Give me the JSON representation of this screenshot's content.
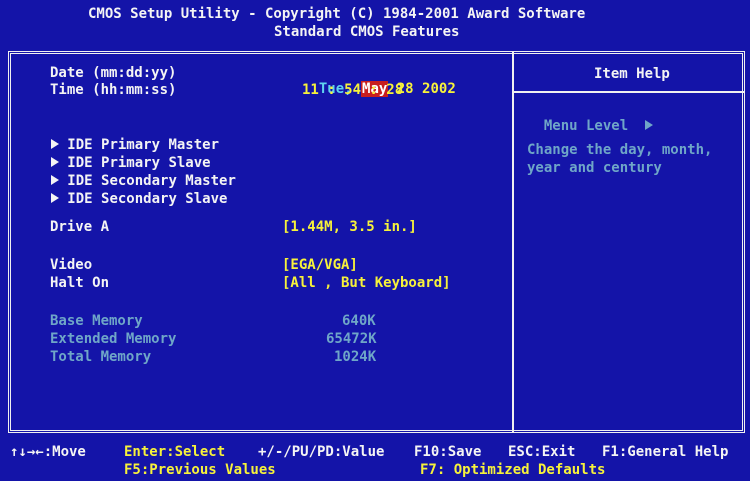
{
  "title": {
    "line1": "CMOS Setup Utility - Copyright (C) 1984-2001 Award Software",
    "line2": "Standard CMOS Features"
  },
  "fields": {
    "date": {
      "label": "Date (mm:dd:yy)",
      "day": "Tue,",
      "month": "May",
      "rest": "28 2002"
    },
    "time": {
      "label": "Time (hh:mm:ss)",
      "value": "11 : 54 : 28"
    },
    "ide": [
      {
        "label": "IDE Primary Master"
      },
      {
        "label": "IDE Primary Slave"
      },
      {
        "label": "IDE Secondary Master"
      },
      {
        "label": "IDE Secondary Slave"
      }
    ],
    "drive_a": {
      "label": "Drive A",
      "value": "[1.44M, 3.5 in.]"
    },
    "video": {
      "label": "Video",
      "value": "[EGA/VGA]"
    },
    "halt_on": {
      "label": "Halt On",
      "value": "[All , But Keyboard]"
    },
    "base_memory": {
      "label": "Base Memory",
      "value": "640K"
    },
    "extended_memory": {
      "label": "Extended Memory",
      "value": "65472K"
    },
    "total_memory": {
      "label": "Total Memory",
      "value": "1024K"
    }
  },
  "help": {
    "header": "Item Help",
    "menu_level": "Menu Level",
    "text_line1": "Change the day, month,",
    "text_line2": "year and century"
  },
  "footer": {
    "move": "↑↓→←:Move",
    "select": "Enter:Select",
    "value": "+/-/PU/PD:Value",
    "save": "F10:Save",
    "exit": "ESC:Exit",
    "help": "F1:General Help",
    "previous": "F5:Previous Values",
    "optimized": "F7: Optimized Defaults"
  },
  "colors": {
    "background": "#1414a8",
    "label": "#f4f4f4",
    "value": "#f7f23a",
    "highlight": "#c81e1e",
    "memory": "#6fa6c8",
    "date_day": "#5fd2f0"
  }
}
